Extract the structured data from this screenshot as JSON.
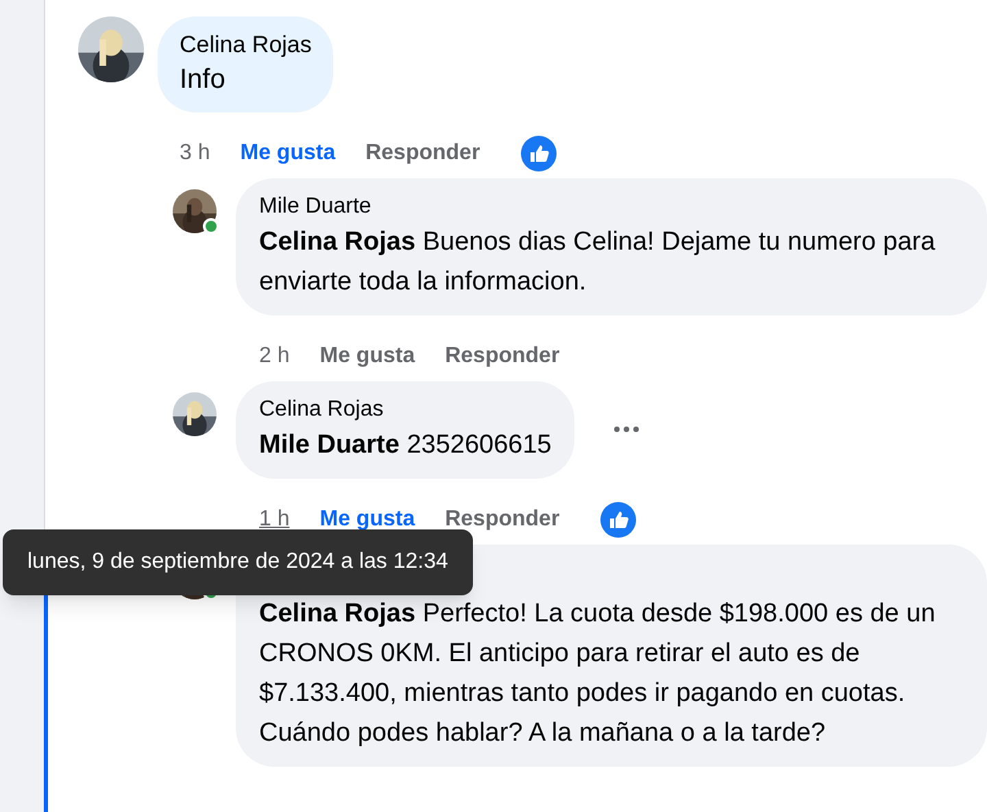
{
  "comment": {
    "author": "Celina Rojas",
    "text": "Info",
    "time": "3 h",
    "time_hovered": false,
    "like_label": "Me gusta",
    "reply_label": "Responder",
    "liked": true,
    "reaction": true,
    "online": false
  },
  "replies": [
    {
      "author": "Mile Duarte",
      "mention": "Celina Rojas",
      "text": "Buenos dias Celina! Dejame tu numero para enviarte toda la informacion.",
      "time": "2 h",
      "time_hovered": false,
      "like_label": "Me gusta",
      "reply_label": "Responder",
      "liked": false,
      "reaction": false,
      "online": true,
      "more_menu": false
    },
    {
      "author": "Celina Rojas",
      "mention": "Mile Duarte",
      "text": "2352606615",
      "time": "1 h",
      "time_hovered": true,
      "like_label": "Me gusta",
      "reply_label": "Responder",
      "liked": true,
      "reaction": true,
      "online": false,
      "more_menu": true
    },
    {
      "mention": "Celina Rojas",
      "text": "Perfecto! La cuota desde $198.000 es de un CRONOS 0KM. El anticipo para retirar el auto es de $7.133.400, mientras tanto podes ir pagando en cuotas. Cuándo podes hablar? A la mañana o a la tarde?",
      "online": true,
      "more_menu": false
    }
  ],
  "tooltip": {
    "text": "lunes, 9 de septiembre de 2024 a las 12:34"
  }
}
